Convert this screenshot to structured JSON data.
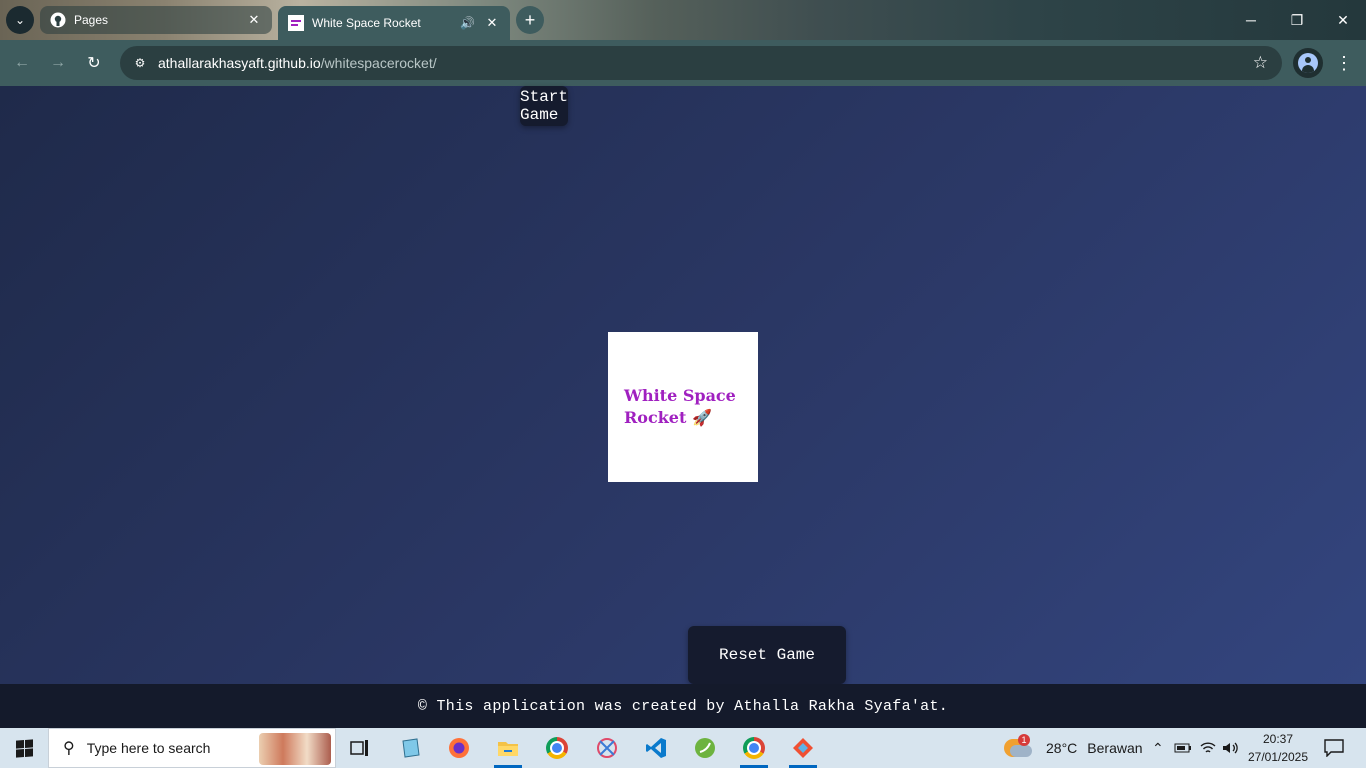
{
  "browser": {
    "tabs": [
      {
        "title": "Pages",
        "icon": "github-icon",
        "active": false
      },
      {
        "title": "White Space Rocket",
        "icon": "site-favicon",
        "active": true,
        "audio": true
      }
    ],
    "url_host": "athallarakhasyaft.github.io",
    "url_path": "/whitespacerocket/"
  },
  "page": {
    "logo_line1": "White Space",
    "logo_line2": "Rocket 🚀",
    "start_label": "Start Game",
    "reset_label": "Reset Game",
    "footer": "© This application was created by Athalla Rakha Syafa'at."
  },
  "taskbar": {
    "search_placeholder": "Type here to search",
    "weather_temp": "28°C",
    "weather_desc": "Berawan",
    "weather_badge": "1",
    "time": "20:37",
    "date": "27/01/2025"
  },
  "colors": {
    "chrome_toolbar": "#3e5c5e",
    "page_bg": "#2b3866",
    "button_bg": "#151b2e",
    "logo_text": "#a020c0"
  }
}
